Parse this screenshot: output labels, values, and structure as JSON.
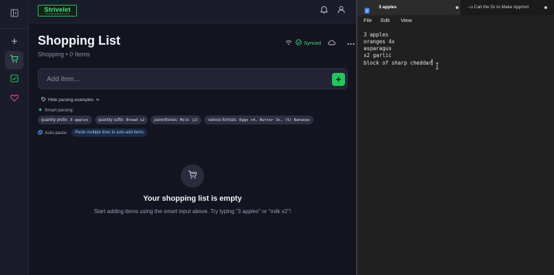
{
  "app": {
    "logo": {
      "name": "Strivelet",
      "tagline": "BUILT FOR EVERYDAY LISTS"
    },
    "icons": {
      "sidebar_toggle": "panel-left-icon",
      "add": "plus-icon",
      "cart": "shopping-cart-icon",
      "check": "check-square-icon",
      "heart": "heart-icon",
      "bell": "bell-icon",
      "user": "user-icon",
      "wifi": "wifi-icon",
      "synced": "check-circle-icon",
      "cloud": "cloud-icon",
      "more": "more-horizontal-icon"
    },
    "accent_color": "#22c55e",
    "page_title": "Shopping List",
    "subtitle": "Shopping • 0 Items",
    "sync_status": "Synced",
    "add_item": {
      "placeholder": "Add item..."
    },
    "examples": {
      "toggle_label": "Hide parsing examples",
      "smart_parsing_label": "Smart parsing:",
      "chips": [
        {
          "label": "quantity prefix:",
          "code": "3 apples"
        },
        {
          "label": "quantity suffix:",
          "code": "Bread x2"
        },
        {
          "label": "parentheses:",
          "code": "Milk (2)"
        },
        {
          "label": "various formats:",
          "code": "Eggs x4, Butter 3x, (5) Bananas"
        }
      ],
      "autopaste_label": "Auto-paste:",
      "autopaste_hint": "Paste multiple lines to auto-add items"
    },
    "empty_state": {
      "title": "Your shopping list is empty",
      "subtitle": "Start adding items using the smart input above. Try typing \"3 apples\" or \"milk x2\"!"
    }
  },
  "editor": {
    "tabs": [
      {
        "label": "3 apples",
        "active": true
      },
      {
        "label": "--u Call the Dr to Make Appmnt",
        "active": false
      }
    ],
    "menu": [
      "File",
      "Edit",
      "View"
    ],
    "lines": [
      "3 apples",
      "oranges 4x",
      "asparagus",
      "x2 garlic",
      "block of sharp cheddar"
    ]
  }
}
